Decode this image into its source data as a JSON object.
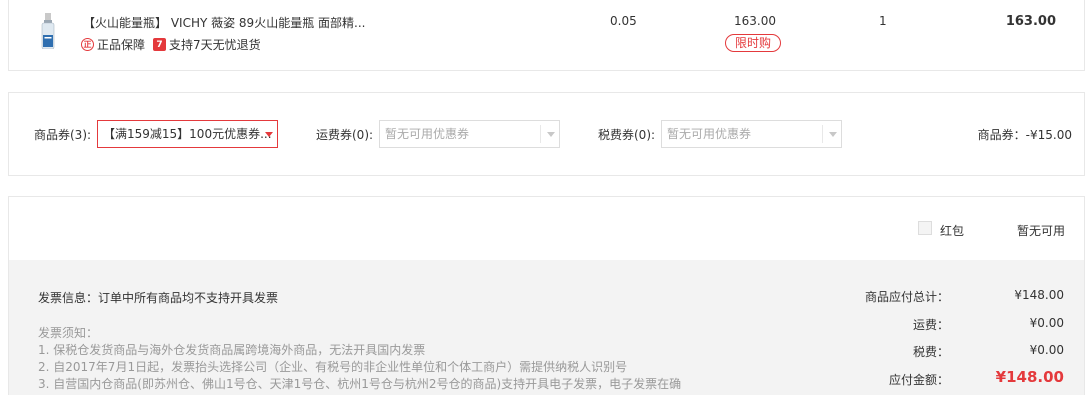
{
  "product": {
    "thumb_icon": "serum-bottle-icon",
    "title": "【火山能量瓶】 VICHY 薇姿 89火山能量瓶 面部精...",
    "badges": [
      {
        "icon": "genuine-icon",
        "icon_text": "正",
        "label": "正品保障"
      },
      {
        "icon": "return-7day-icon",
        "icon_text": "7",
        "label": "支持7天无忧退货"
      }
    ],
    "tax": "0.05",
    "price": "163.00",
    "promo_tag": "限时购",
    "quantity": "1",
    "subtotal": "163.00"
  },
  "coupons": {
    "goods_label": "商品券(3):",
    "goods_value": "【满159减15】100元优惠券...",
    "shipping_label": "运费券(0):",
    "shipping_value": "暂无可用优惠券",
    "tax_label": "税费券(0):",
    "tax_value": "暂无可用优惠券",
    "discount_summary": "商品券：-¥15.00"
  },
  "red_packet": {
    "label": "红包",
    "status": "暂无可用"
  },
  "invoice": {
    "info": "发票信息：订单中所有商品均不支持开具发票",
    "notice_title": "发票须知：",
    "notice_lines": [
      "1. 保税仓发货商品与海外仓发货商品属跨境海外商品，无法开具国内发票",
      "2. 自2017年7月1日起，发票抬头选择公司（企业、有税号的非企业性单位和个体工商户）需提供纳税人识别号",
      "3. 自营国内仓商品(即苏州仓、佛山1号仓、天津1号仓、杭州1号仓与杭州2号仓的商品)支持开具电子发票，电子发票在确"
    ]
  },
  "summary": {
    "goods_total_label": "商品应付总计：",
    "goods_total": "¥148.00",
    "shipping_label": "运费：",
    "shipping": "¥0.00",
    "tax_label": "税费：",
    "tax": "¥0.00",
    "payable_label": "应付金额：",
    "payable": "¥148.00"
  },
  "colors": {
    "accent": "#e4393c",
    "muted": "#999999",
    "summary_bg": "#f3f3f3"
  }
}
